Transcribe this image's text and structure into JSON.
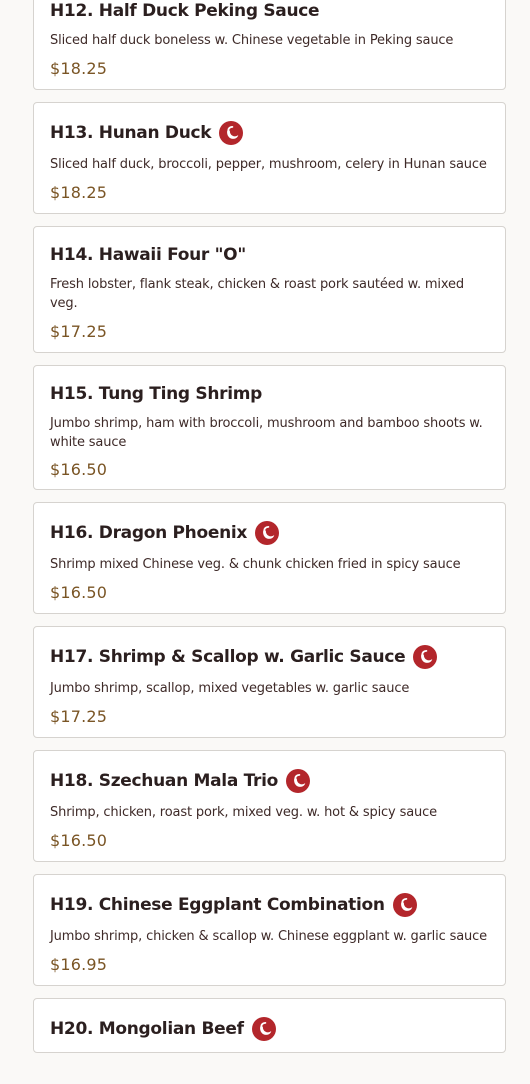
{
  "colors": {
    "background": "#faf9f7",
    "card_border": "#d6d3cf",
    "title": "#2b1f1f",
    "description": "#3e2a28",
    "price": "#7a5525",
    "spicy_icon": "#b3262b"
  },
  "menu": {
    "items": [
      {
        "name": "H12. Half Duck Peking Sauce",
        "spicy": false,
        "spicy_icon": "chili-pepper-icon",
        "description": "Sliced half duck boneless w. Chinese vegetable in Peking sauce",
        "price": "$18.25"
      },
      {
        "name": "H13. Hunan Duck",
        "spicy": true,
        "spicy_icon": "chili-pepper-icon",
        "description": "Sliced half duck, broccoli, pepper, mushroom, celery in Hunan sauce",
        "price": "$18.25"
      },
      {
        "name": "H14. Hawaii Four \"O\"",
        "spicy": false,
        "spicy_icon": "chili-pepper-icon",
        "description": "Fresh lobster, flank steak, chicken & roast pork sautéed w. mixed veg.",
        "price": "$17.25"
      },
      {
        "name": "H15. Tung Ting Shrimp",
        "spicy": false,
        "spicy_icon": "chili-pepper-icon",
        "description": "Jumbo shrimp, ham with broccoli, mushroom and bamboo shoots w. white sauce",
        "price": "$16.50"
      },
      {
        "name": "H16. Dragon Phoenix",
        "spicy": true,
        "spicy_icon": "chili-pepper-icon",
        "description": "Shrimp mixed Chinese veg. & chunk chicken fried in spicy sauce",
        "price": "$16.50"
      },
      {
        "name": "H17. Shrimp & Scallop w. Garlic Sauce",
        "spicy": true,
        "spicy_icon": "chili-pepper-icon",
        "description": "Jumbo shrimp, scallop, mixed vegetables w. garlic sauce",
        "price": "$17.25"
      },
      {
        "name": "H18. Szechuan Mala Trio",
        "spicy": true,
        "spicy_icon": "chili-pepper-icon",
        "description": "Shrimp, chicken, roast pork, mixed veg. w. hot & spicy sauce",
        "price": "$16.50"
      },
      {
        "name": "H19. Chinese Eggplant Combination",
        "spicy": true,
        "spicy_icon": "chili-pepper-icon",
        "description": "Jumbo shrimp, chicken & scallop w. Chinese eggplant w. garlic sauce",
        "price": "$16.95"
      },
      {
        "name": "H20. Mongolian Beef",
        "spicy": true,
        "spicy_icon": "chili-pepper-icon",
        "description": "",
        "price": ""
      }
    ]
  }
}
